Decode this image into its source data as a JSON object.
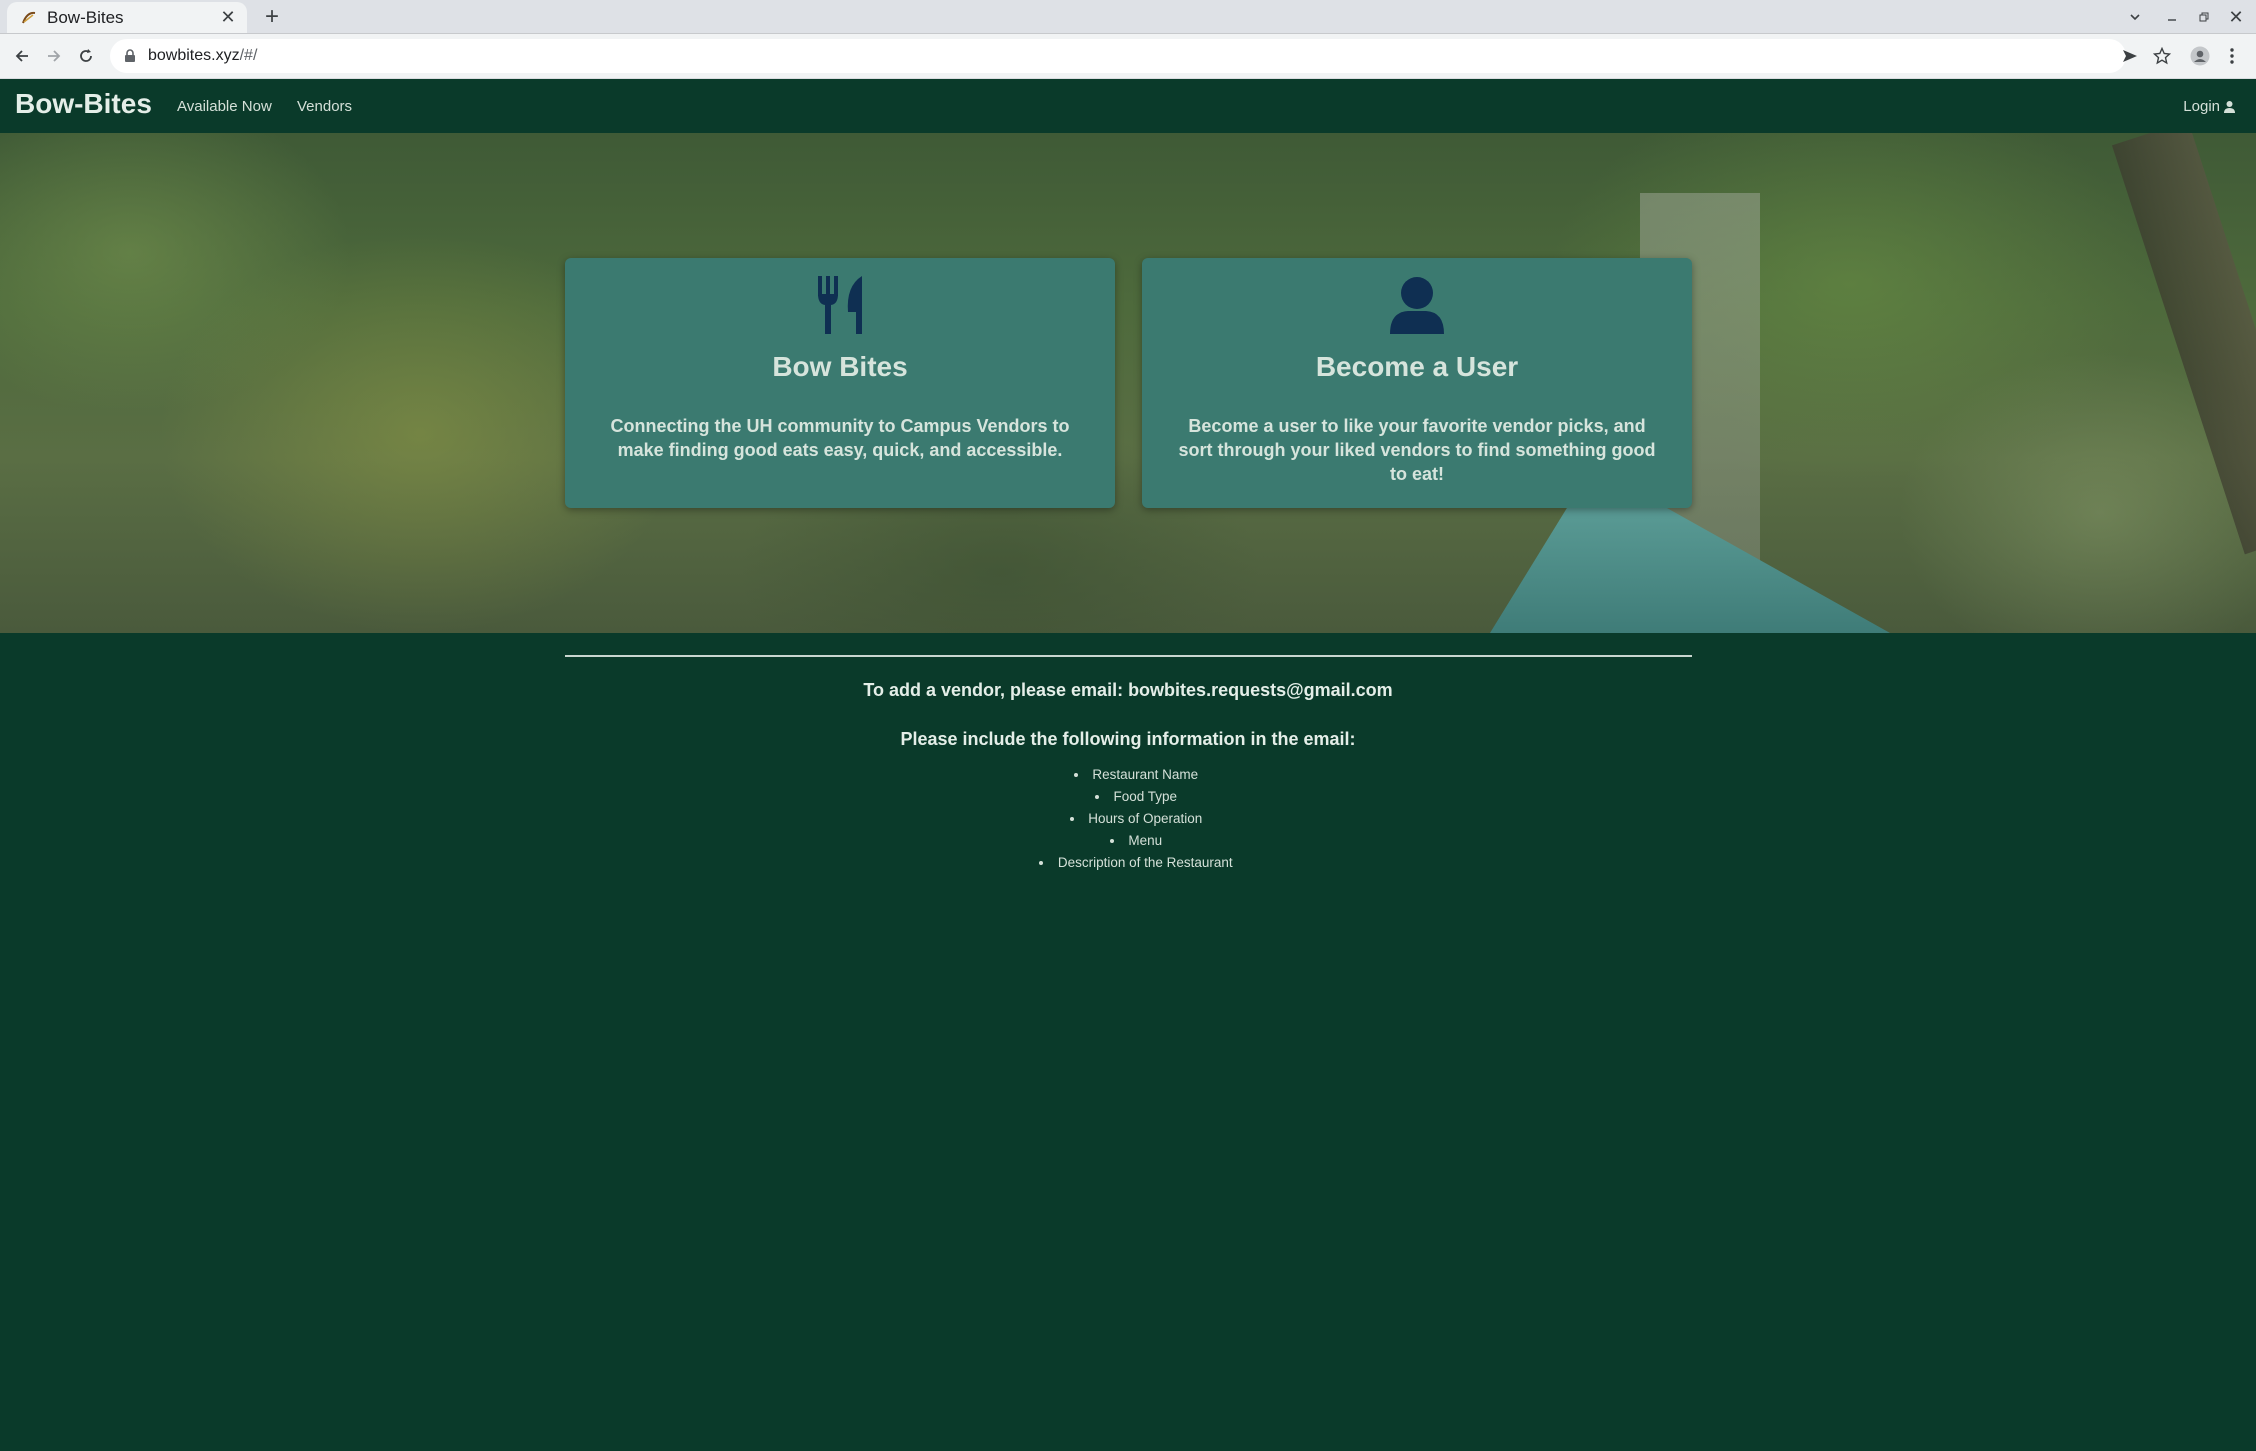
{
  "browser": {
    "tab_title": "Bow-Bites",
    "new_tab": "+",
    "url_host": "bowbites.xyz",
    "url_path": "/#/"
  },
  "nav": {
    "brand": "Bow-Bites",
    "links": [
      "Available Now",
      "Vendors"
    ],
    "login": "Login"
  },
  "cards": [
    {
      "icon": "utensils-icon",
      "title": "Bow Bites",
      "text": "Connecting the UH community to Campus Vendors to make finding good eats easy, quick, and accessible."
    },
    {
      "icon": "user-icon",
      "title": "Become a User",
      "text": "Become a user to like your favorite vendor picks, and sort through your liked vendors to find something good to eat!"
    }
  ],
  "info": {
    "email_line": "To add a vendor, please email: bowbites.requests@gmail.com",
    "include_line": "Please include the following information in the email:",
    "items": [
      "Restaurant Name",
      "Food Type",
      "Hours of Operation",
      "Menu",
      "Description of the Restaurant"
    ]
  },
  "colors": {
    "page_bg": "#0a3a2a",
    "card_bg": "#3b7a70",
    "icon_color": "#0f2f52"
  }
}
